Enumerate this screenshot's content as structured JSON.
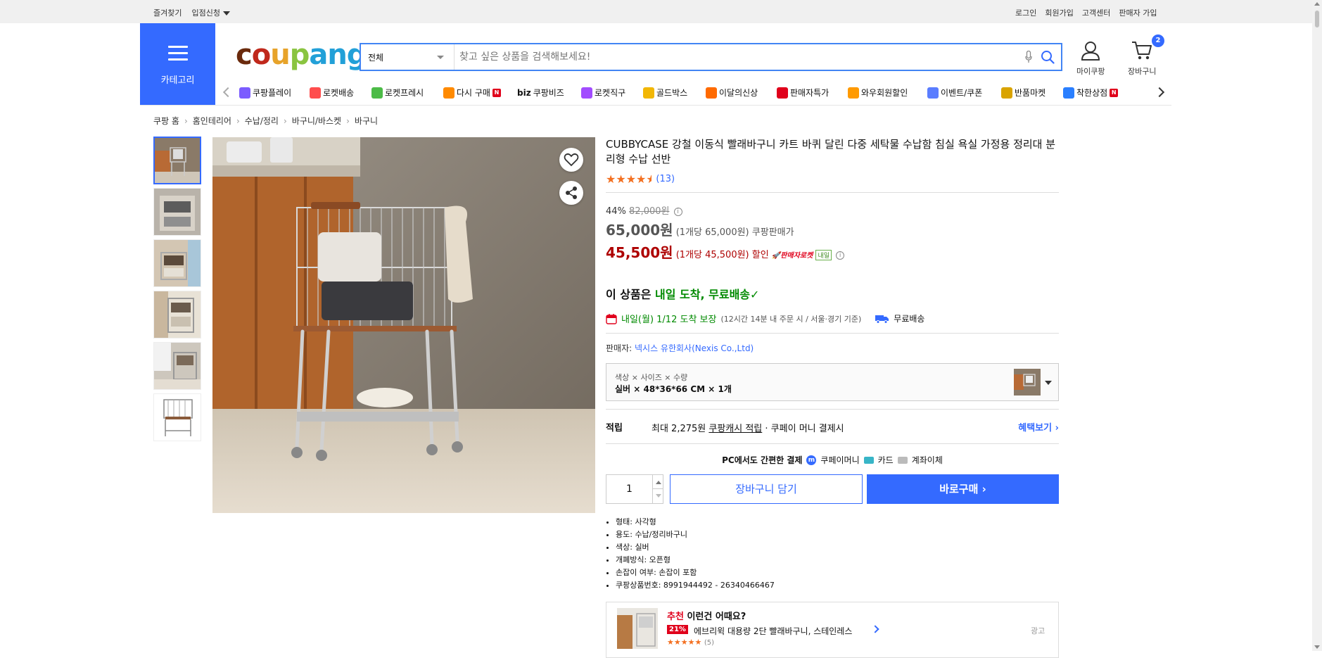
{
  "topbar": {
    "left": [
      "즐겨찾기",
      "입점신청"
    ],
    "right": [
      "로그인",
      "회원가입",
      "고객센터",
      "판매자 가입"
    ]
  },
  "category_label": "카테고리",
  "logo": {
    "parts": [
      "c",
      "o",
      "u",
      "p",
      "ang"
    ]
  },
  "search": {
    "category": "전체",
    "placeholder": "찾고 싶은 상품을 검색해보세요!"
  },
  "header_icons": {
    "mypage": "마이쿠팡",
    "cart": "장바구니",
    "cart_count": "2"
  },
  "nav": [
    {
      "label": "쿠팡플레이",
      "icon": "play-icon",
      "color": "#7b5cff"
    },
    {
      "label": "로켓배송",
      "icon": "rocket-icon",
      "color": "#ff4d4d"
    },
    {
      "label": "로켓프레시",
      "icon": "rocket-fresh-icon",
      "color": "#4cbb47"
    },
    {
      "label": "다시 구매",
      "icon": "rebuy-icon",
      "color": "#ff8a00",
      "badge": "N"
    },
    {
      "label": "쿠팡비즈",
      "icon": "biz-icon",
      "color": "#111111",
      "prefix": "biz"
    },
    {
      "label": "로켓직구",
      "icon": "global-rocket-icon",
      "color": "#a24cff"
    },
    {
      "label": "골드박스",
      "icon": "goldbox-icon",
      "color": "#f2b705"
    },
    {
      "label": "이달의신상",
      "icon": "new-bag-icon",
      "color": "#ff6a00"
    },
    {
      "label": "판매자특가",
      "icon": "seller-sale-icon",
      "color": "#e0001b"
    },
    {
      "label": "와우회원할인",
      "icon": "wow-icon",
      "color": "#ff9a00"
    },
    {
      "label": "이벤트/쿠폰",
      "icon": "coupon-icon",
      "color": "#5a7dff"
    },
    {
      "label": "반품마켓",
      "icon": "return-market-icon",
      "color": "#d9a300"
    },
    {
      "label": "착한상점",
      "icon": "good-store-icon",
      "color": "#2a7fff",
      "badge": "N"
    }
  ],
  "breadcrumb": [
    "쿠팡 홈",
    "홈인테리어",
    "수납/정리",
    "바구니/바스켓",
    "바구니"
  ],
  "product": {
    "title": "CUBBYCASE 강철 이동식 빨래바구니 카트 바퀴 달린 다중 세탁물 수납함 침실 욕실 가정용 정리대 분리형 수납 선반",
    "rating_stars": 4.5,
    "review_count": "(13)",
    "discount_rate": "44%",
    "original_price": "82,000원",
    "price": "65,000원",
    "unit_price": "(1개당 65,000원)",
    "price_type": "쿠팡판매가",
    "sale_price": "45,500원",
    "sale_unit_price": "(1개당 45,500원)",
    "sale_label": "할인",
    "seller_rocket": "판매자로켓",
    "naeil": "내일",
    "delivery_head_prefix": "이 상품은 ",
    "delivery_head_green": "내일 도착, 무료배송",
    "delivery_date": "내일(월) 1/12 도착 보장",
    "delivery_note": "(12시간 14분 내 주문 시 / 서울·경기 기준)",
    "free_shipping": "무료배송",
    "seller_label": "판매자: ",
    "seller_name": "넥시스 유한회사(Nexis Co.,Ltd)",
    "option_header": "색상 × 사이즈 × 수량",
    "option_value": "실버 × 48*36*66 CM × 1개",
    "cash_label": "적립",
    "cash_text_prefix": "최대 2,275원 ",
    "cash_link": "쿠팡캐시 적립",
    "cash_text_suffix": " · 쿠페이 머니 결제시",
    "benefit": "혜택보기",
    "pay_prefix": "PC에서도 간편한 결제",
    "pay_coupay": "쿠페이머니",
    "pay_card": "카드",
    "pay_bank": "계좌이체",
    "quantity": "1",
    "add_cart": "장바구니 담기",
    "buy_now": "바로구매",
    "attributes": [
      "형태: 사각형",
      "용도: 수납/정리바구니",
      "색상: 실버",
      "개폐방식: 오픈형",
      "손잡이 여부: 손잡이 포함",
      "쿠팡상품번호: 8991944492 - 26340466467"
    ]
  },
  "recommend": {
    "title_red": "추천",
    "title_rest": " 이런건 어때요?",
    "discount": "21%",
    "name": "에브리윅 대용량 2단 빨래바구니, 스테인레스",
    "stars": 5,
    "count": "(5)",
    "ad": "광고"
  }
}
